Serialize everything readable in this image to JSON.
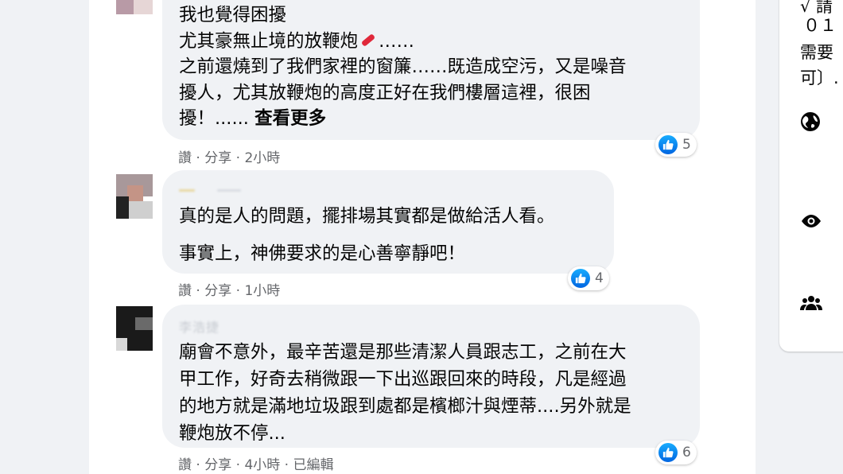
{
  "comments": [
    {
      "lines": [
        "我也覺得困擾",
        "尤其豪無止境的放鞭炮",
        "之前還燒到了我們家裡的窗簾……既造成空污，又是噪音",
        "擾人，尤其放鞭炮的高度正好在我們樓層這裡，很困"
      ],
      "line2_suffix": "……",
      "last_prefix": "擾！......",
      "see_more": "查看更多",
      "like": "讚",
      "share": "分享",
      "time": "2小時",
      "reactions": "5"
    },
    {
      "lines": [
        "真的是人的問題，擺排場其實都是做給活人看。",
        "事實上，神佛要求的是心善寧靜吧！"
      ],
      "like": "讚",
      "share": "分享",
      "time": "1小時",
      "reactions": "4"
    },
    {
      "author": "李浩捷",
      "lines": [
        "廟會不意外，最辛苦還是那些清潔人員跟志工，之前在大",
        "甲工作，好奇去稍微跟一下出巡跟回來的時段，凡是經過",
        "的地方就是滿地垃圾跟到處都是檳榔汁與煙蒂....另外就是",
        "鞭炮放不停..."
      ],
      "like": "讚",
      "share": "分享",
      "time": "4小時",
      "edited": "已編輯",
      "reactions": "6"
    }
  ],
  "separator": "·",
  "sidebar": {
    "line1": "√ 請",
    "line2": "０１",
    "line3": "需要",
    "line4": "可〕.",
    "icons": [
      "globe-icon",
      "eye-icon",
      "group-icon"
    ]
  },
  "colors": {
    "like_blue": "#0571ed",
    "meta_gray": "#65676b",
    "bubble": "#f0f2f5"
  }
}
